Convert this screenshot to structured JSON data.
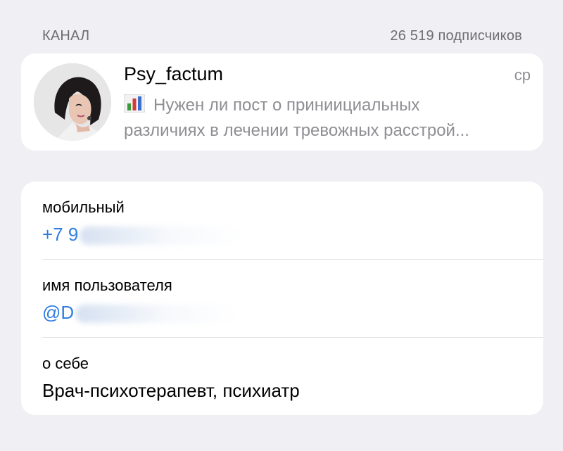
{
  "section_header": {
    "title": "КАНАЛ",
    "subscribers": "26 519 подписчиков"
  },
  "channel": {
    "name": "Psy_factum",
    "time": "ср",
    "preview_line1": "Нужен ли пост о приниициальных",
    "preview_line2": "различиях в лечении тревожных расстрой...",
    "preview_icon": "bar-chart-emoji"
  },
  "info": {
    "mobile_label": "мобильный",
    "mobile_value": "+7 9",
    "username_label": "имя пользователя",
    "username_value": "@D",
    "about_label": "о себе",
    "about_value": "Врач-психотерапевт, психиатр"
  },
  "colors": {
    "background": "#efeff4",
    "card": "#ffffff",
    "link": "#2f7de1",
    "secondary_text": "#8e8e93"
  }
}
